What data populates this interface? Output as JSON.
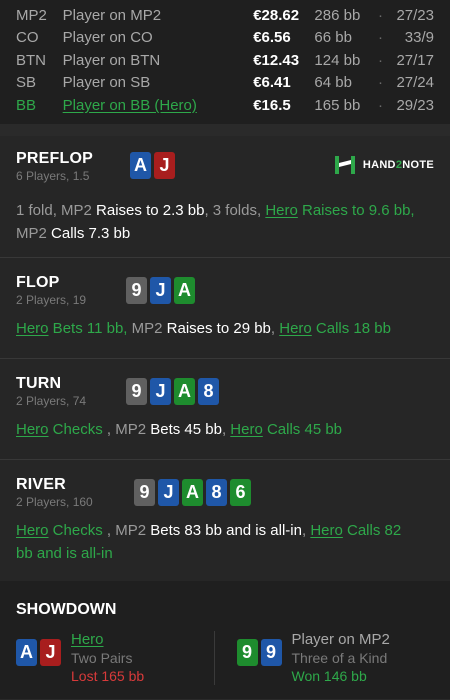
{
  "players": [
    {
      "pos": "MP2",
      "name": "Player on MP2",
      "stack": "€28.62",
      "bb": "286 bb",
      "sep": "·",
      "ratio": "27/23",
      "hero": false
    },
    {
      "pos": "CO",
      "name": "Player on CO",
      "stack": "€6.56",
      "bb": "66 bb",
      "sep": "·",
      "ratio": "33/9",
      "hero": false
    },
    {
      "pos": "BTN",
      "name": "Player on BTN",
      "stack": "€12.43",
      "bb": "124 bb",
      "sep": "·",
      "ratio": "27/17",
      "hero": false
    },
    {
      "pos": "SB",
      "name": "Player on SB",
      "stack": "€6.41",
      "bb": "64 bb",
      "sep": "·",
      "ratio": "27/24",
      "hero": false
    },
    {
      "pos": "BB",
      "name": "Player on BB (Hero)",
      "stack": "€16.5",
      "bb": "165 bb",
      "sep": "·",
      "ratio": "29/23",
      "hero": true
    }
  ],
  "logo": {
    "text_a": "HAND",
    "text_b": "2",
    "text_c": "NOTE"
  },
  "streets": {
    "preflop": {
      "name": "PREFLOP",
      "sub": "6 Players, 1.5",
      "cards": [
        {
          "r": "A",
          "color": "#1f57a8"
        },
        {
          "r": "J",
          "color": "#a81e1e"
        }
      ],
      "a1": "1 fold, MP2 ",
      "a2": "Raises to 2.3 bb",
      "a3": ", 3 folds, ",
      "a4": "Hero",
      "a5": " Raises to 9.6 bb,",
      "a6": "MP2 ",
      "a7": "Calls 7.3 bb"
    },
    "flop": {
      "name": "FLOP",
      "sub": "2 Players, 19",
      "cards": [
        {
          "r": "9",
          "color": "#606060"
        },
        {
          "r": "J",
          "color": "#1f57a8"
        },
        {
          "r": "A",
          "color": "#1e8c2e"
        }
      ],
      "a1": "Hero",
      "a2": " Bets 11 bb,",
      "a3": " MP2 ",
      "a4": "Raises to 29 bb",
      "a5": ", ",
      "a6": "Hero",
      "a7": " Calls 18 bb"
    },
    "turn": {
      "name": "TURN",
      "sub": "2 Players, 74",
      "cards": [
        {
          "r": "9",
          "color": "#606060"
        },
        {
          "r": "J",
          "color": "#1f57a8"
        },
        {
          "r": "A",
          "color": "#1e8c2e"
        },
        {
          "r": "8",
          "color": "#1f57a8"
        }
      ],
      "a1": "Hero",
      "a2": " Checks",
      "a3": " , MP2 ",
      "a4": "Bets 45 bb",
      "a5": ", ",
      "a6": "Hero",
      "a7": " Calls 45 bb"
    },
    "river": {
      "name": "RIVER",
      "sub": "2 Players, 160",
      "cards": [
        {
          "r": "9",
          "color": "#606060"
        },
        {
          "r": "J",
          "color": "#1f57a8"
        },
        {
          "r": "A",
          "color": "#1e8c2e"
        },
        {
          "r": "8",
          "color": "#1f57a8"
        },
        {
          "r": "6",
          "color": "#1e8c2e"
        }
      ],
      "a1": "Hero",
      "a2": " Checks",
      "a3": " , MP2 ",
      "a4": "Bets 83 bb and is all-in",
      "a5": ", ",
      "a6": "Hero",
      "a7": " Calls 82",
      "a8": "bb and is all-in"
    }
  },
  "showdown": {
    "title": "SHOWDOWN",
    "hero": {
      "name": "Hero",
      "hand": "Two Pairs",
      "result": "Lost 165 bb",
      "cards": [
        {
          "r": "A",
          "color": "#1f57a8"
        },
        {
          "r": "J",
          "color": "#a81e1e"
        }
      ]
    },
    "villain": {
      "name": "Player on MP2",
      "hand": "Three of a Kind",
      "result": "Won 146 bb",
      "cards": [
        {
          "r": "9",
          "color": "#1e8c2e"
        },
        {
          "r": "9",
          "color": "#1f57a8"
        }
      ]
    }
  }
}
